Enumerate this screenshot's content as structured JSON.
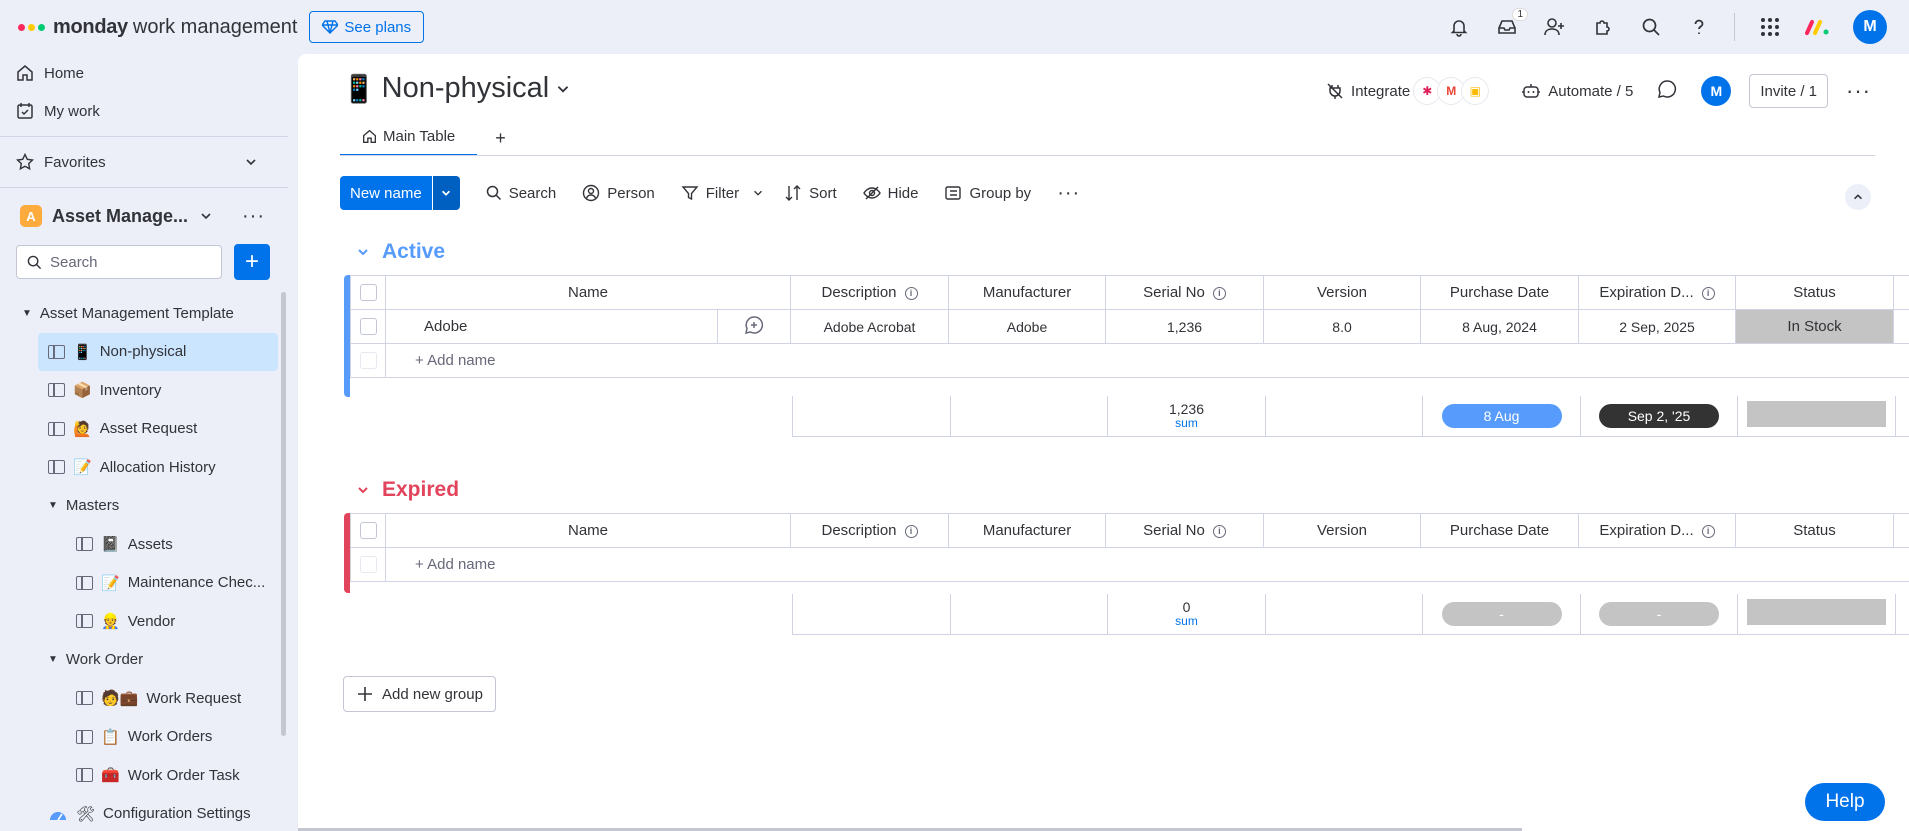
{
  "topbar": {
    "brand_main": "monday",
    "brand_sub": "work management",
    "see_plans_label": "See plans",
    "inbox_badge": "1",
    "avatar_initial": "M",
    "colors": {
      "accent": "#0073ea",
      "logo_dot_1": "#fb275d",
      "logo_dot_2": "#ffcb00",
      "logo_dot_3": "#00ca72"
    }
  },
  "sidebar": {
    "nav": [
      {
        "label": "Home",
        "icon": "home-icon"
      },
      {
        "label": "My work",
        "icon": "calendar-check-icon"
      }
    ],
    "favorites_label": "Favorites",
    "workspace": {
      "badge": "A",
      "title": "Asset Manage..."
    },
    "search_placeholder": "Search",
    "tree": {
      "root": "Asset Management Template",
      "non_physical": {
        "emoji": "📱",
        "label": "Non-physical"
      },
      "inventory": {
        "emoji": "📦",
        "label": "Inventory"
      },
      "asset_request": {
        "emoji": "🙋",
        "label": "Asset Request"
      },
      "allocation_history": {
        "emoji": "📝",
        "label": "Allocation History"
      },
      "masters": "Masters",
      "assets": {
        "emoji": "📓",
        "label": "Assets"
      },
      "maintenance": {
        "emoji": "📝",
        "label": "Maintenance Chec..."
      },
      "vendor": {
        "emoji": "👷",
        "label": "Vendor"
      },
      "work_order": "Work Order",
      "work_request": {
        "emoji": "🧑💼",
        "label": "Work Request"
      },
      "work_orders": {
        "emoji": "📋",
        "label": "Work Orders"
      },
      "work_order_task": {
        "emoji": "🧰",
        "label": "Work Order Task"
      },
      "config": {
        "emoji": "🛠",
        "label": "Configuration Settings"
      }
    }
  },
  "board": {
    "emoji": "📱",
    "title": "Non-physical",
    "tab_main": "Main Table",
    "tab_add": "+",
    "integrate_label": "Integrate",
    "automate_label": "Automate / 5",
    "avatar_initial": "M",
    "invite_label": "Invite / 1"
  },
  "toolbar": {
    "new_label": "New name",
    "search_label": "Search",
    "person_label": "Person",
    "filter_label": "Filter",
    "sort_label": "Sort",
    "hide_label": "Hide",
    "group_by_label": "Group by"
  },
  "columns": {
    "name": "Name",
    "description": "Description",
    "manufacturer": "Manufacturer",
    "serial": "Serial No",
    "version": "Version",
    "purchase_date": "Purchase Date",
    "expiration": "Expiration D...",
    "status": "Status"
  },
  "groups": {
    "active": {
      "title": "Active",
      "color": "#579bfc",
      "rows": [
        {
          "name": "Adobe",
          "description": "Adobe Acrobat",
          "manufacturer": "Adobe",
          "serial": "1,236",
          "version": "8.0",
          "purchase_date": "8 Aug, 2024",
          "expiration": "2 Sep, 2025",
          "status": "In Stock"
        }
      ],
      "add_label": "+ Add name",
      "summary": {
        "serial": "1,236",
        "serial_label": "sum",
        "purchase": "8 Aug",
        "expiration": "Sep 2, '25"
      }
    },
    "expired": {
      "title": "Expired",
      "color": "#e2445c",
      "add_label": "+ Add name",
      "summary": {
        "serial": "0",
        "serial_label": "sum",
        "purchase": "-",
        "expiration": "-"
      }
    }
  },
  "add_group_label": "Add new group",
  "help_label": "Help"
}
